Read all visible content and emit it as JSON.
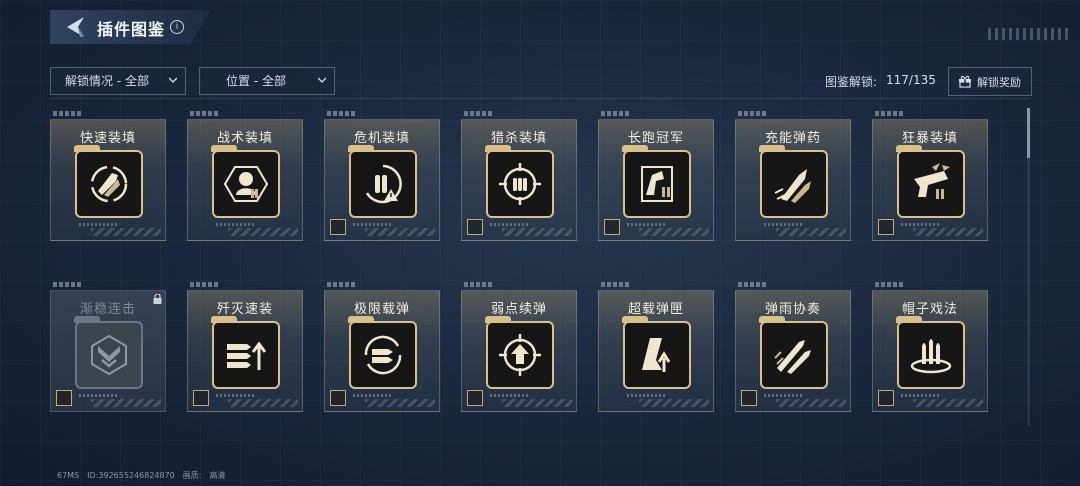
{
  "header": {
    "title": "插件图鉴",
    "info_label": "i"
  },
  "filters": {
    "unlock_status": "解锁情况 - 全部",
    "position": "位置 - 全部"
  },
  "collection": {
    "label": "图鉴解锁:",
    "count": "117/135",
    "reward_button": "解锁奖励"
  },
  "cards": [
    {
      "name": "快速装填",
      "icon": "fast-reload-icon",
      "locked": false,
      "badge": false
    },
    {
      "name": "战术装填",
      "icon": "tactical-reload-icon",
      "locked": false,
      "badge": false
    },
    {
      "name": "危机装填",
      "icon": "crisis-reload-icon",
      "locked": false,
      "badge": true
    },
    {
      "name": "猎杀装填",
      "icon": "hunt-reload-icon",
      "locked": false,
      "badge": true
    },
    {
      "name": "长跑冠军",
      "icon": "marathon-champion-icon",
      "locked": false,
      "badge": true
    },
    {
      "name": "充能弹药",
      "icon": "charged-ammo-icon",
      "locked": false,
      "badge": false
    },
    {
      "name": "狂暴装填",
      "icon": "frenzy-reload-icon",
      "locked": false,
      "badge": true
    },
    {
      "name": "渐稳连击",
      "icon": "steady-combo-icon",
      "locked": true,
      "badge": true
    },
    {
      "name": "歼灭速装",
      "icon": "annihilation-reload-icon",
      "locked": false,
      "badge": true
    },
    {
      "name": "极限载弹",
      "icon": "max-ammo-icon",
      "locked": false,
      "badge": true
    },
    {
      "name": "弱点续弹",
      "icon": "weakpoint-refill-icon",
      "locked": false,
      "badge": true
    },
    {
      "name": "超载弹匣",
      "icon": "overload-magazine-icon",
      "locked": false,
      "badge": false
    },
    {
      "name": "弹雨协奏",
      "icon": "bullet-rain-icon",
      "locked": false,
      "badge": true
    },
    {
      "name": "帽子戏法",
      "icon": "hat-trick-icon",
      "locked": false,
      "badge": true
    }
  ],
  "footer": {
    "ping": "67MS",
    "id": "ID:392655246824870",
    "quality_label": "画质:",
    "quality_value": "高清"
  },
  "colors": {
    "gold": "#d9c08a",
    "background": "#1a2940"
  }
}
